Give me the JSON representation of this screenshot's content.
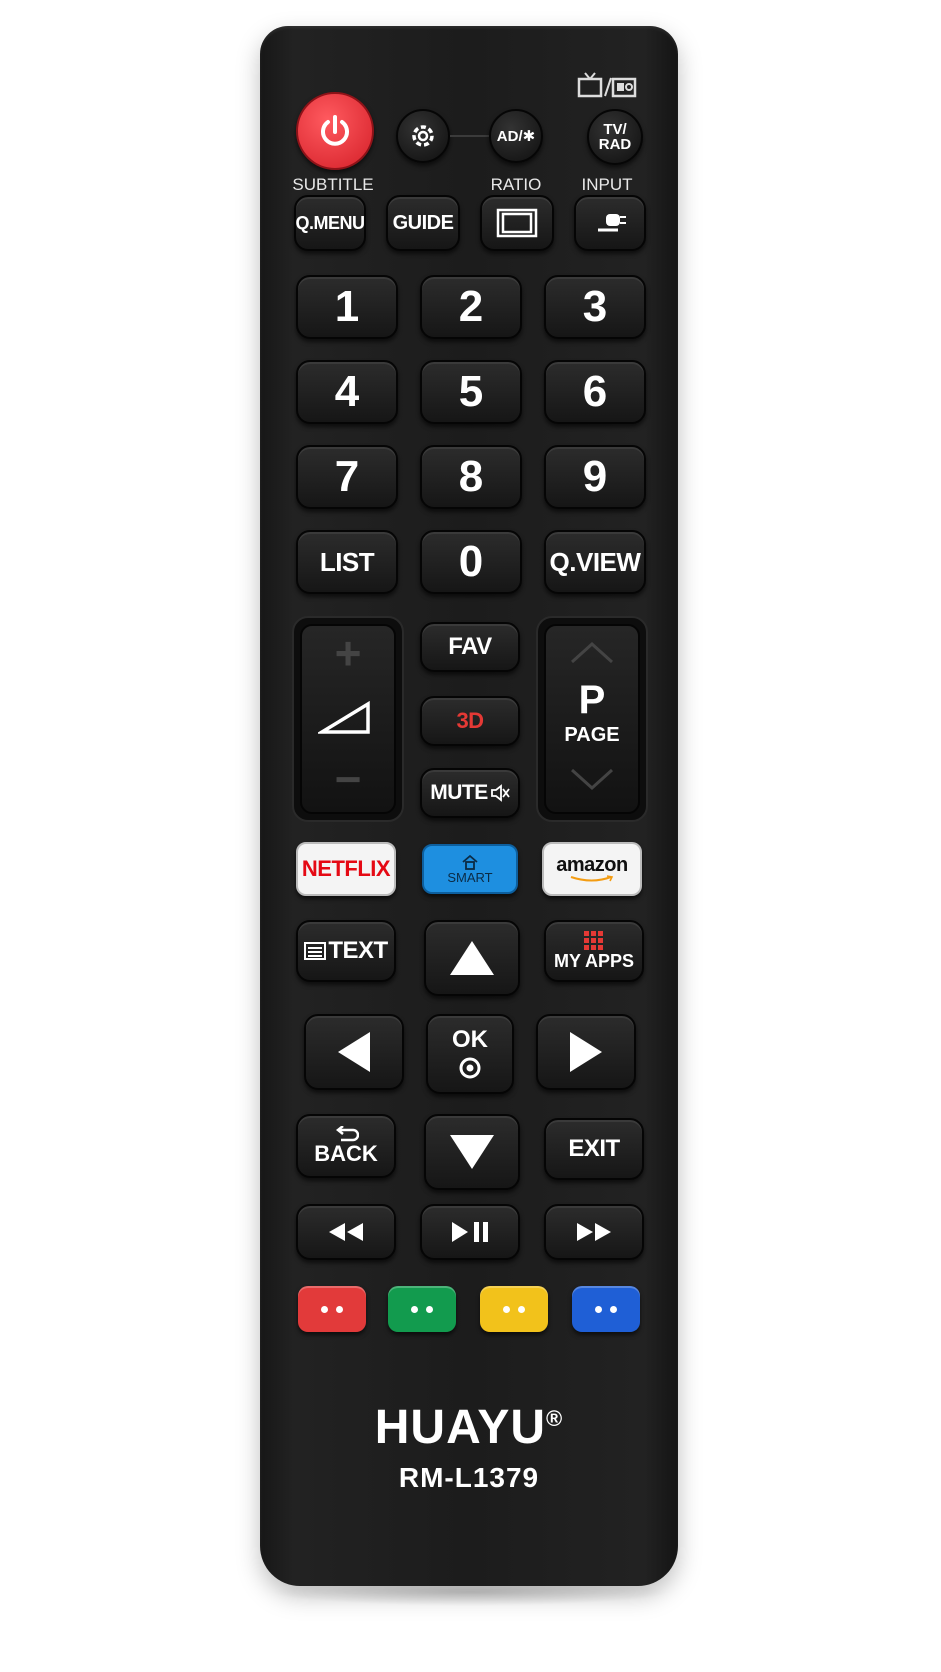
{
  "top_icon": "tv-radio-icon",
  "buttons": {
    "power": "power-icon",
    "settings": "gear-icon",
    "ad": "AD/✱",
    "tvrad": "TV/\nRAD"
  },
  "labels": {
    "subtitle": "SUBTITLE",
    "ratio": "RATIO",
    "input": "INPUT"
  },
  "row2": {
    "qmenu": "Q.MENU",
    "guide": "GUIDE",
    "ratio_icon": "ratio-icon",
    "input_icon": "input-icon"
  },
  "digits": [
    "1",
    "2",
    "3",
    "4",
    "5",
    "6",
    "7",
    "8",
    "9"
  ],
  "row_list": {
    "list": "LIST",
    "zero": "0",
    "qview": "Q.VIEW"
  },
  "volume": {
    "plus": "+",
    "minus": "−",
    "icon": "volume-icon"
  },
  "center": {
    "fav": "FAV",
    "three_d": "3D",
    "mute": "MUTE"
  },
  "page": {
    "p": "P",
    "label": "PAGE"
  },
  "apps": {
    "netflix": "NETFLIX",
    "smart": "SMART",
    "amazon": "amazon"
  },
  "nav": {
    "text": "TEXT",
    "myapps": "MY APPS",
    "ok": "OK",
    "back": "BACK",
    "exit": "EXIT"
  },
  "media": [
    "rewind-icon",
    "play-pause-icon",
    "fast-forward-icon"
  ],
  "colors": {
    "red": "#e23a3a",
    "green": "#129b4e",
    "yellow": "#f2c21b",
    "blue": "#1f5fd6",
    "power": "#e3262f",
    "smart": "#1e8fe0",
    "three_d": "#e53935"
  },
  "brand": {
    "name": "HUAYU",
    "reg": "®",
    "model": "RM-L1379"
  }
}
